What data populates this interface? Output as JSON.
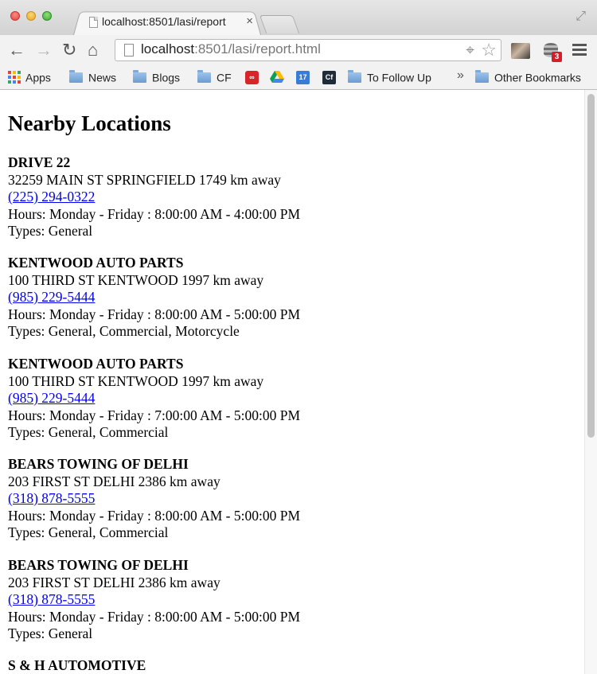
{
  "tab": {
    "title": "localhost:8501/lasi/report",
    "close": "×"
  },
  "address": {
    "host": "localhost",
    "path": ":8501/lasi/report.html"
  },
  "extensions": {
    "badge_count": "3"
  },
  "bookmarks": {
    "items": [
      {
        "label": "Apps",
        "icon": "apps-grid-icon"
      },
      {
        "label": "News",
        "icon": "folder-icon"
      },
      {
        "label": "Blogs",
        "icon": "folder-icon"
      },
      {
        "label": "CF",
        "icon": "folder-icon"
      },
      {
        "label": "",
        "icon": "adobe-cc-icon"
      },
      {
        "label": "",
        "icon": "google-drive-icon"
      },
      {
        "label": "",
        "icon": "calendar-icon",
        "text": "17"
      },
      {
        "label": "",
        "icon": "cf-icon",
        "text": "Cf"
      },
      {
        "label": "To Follow Up",
        "icon": "folder-icon"
      }
    ],
    "overflow": "»",
    "other": "Other Bookmarks"
  },
  "page": {
    "heading": "Nearby Locations",
    "locations": [
      {
        "name": "DRIVE 22",
        "address": "32259 MAIN ST SPRINGFIELD 1749 km away",
        "phone": "(225) 294-0322",
        "hours": "Hours: Monday - Friday : 8:00:00 AM - 4:00:00 PM",
        "types": "Types: General"
      },
      {
        "name": "KENTWOOD AUTO PARTS",
        "address": "100 THIRD ST KENTWOOD 1997 km away",
        "phone": "(985) 229-5444",
        "hours": "Hours: Monday - Friday : 8:00:00 AM - 5:00:00 PM",
        "types": "Types: General, Commercial, Motorcycle"
      },
      {
        "name": "KENTWOOD AUTO PARTS",
        "address": "100 THIRD ST KENTWOOD 1997 km away",
        "phone": "(985) 229-5444",
        "hours": "Hours: Monday - Friday : 7:00:00 AM - 5:00:00 PM",
        "types": "Types: General, Commercial"
      },
      {
        "name": "BEARS TOWING OF DELHI",
        "address": "203 FIRST ST DELHI 2386 km away",
        "phone": "(318) 878-5555",
        "hours": "Hours: Monday - Friday : 8:00:00 AM - 5:00:00 PM",
        "types": "Types: General, Commercial"
      },
      {
        "name": "BEARS TOWING OF DELHI",
        "address": "203 FIRST ST DELHI 2386 km away",
        "phone": "(318) 878-5555",
        "hours": "Hours: Monday - Friday : 8:00:00 AM - 5:00:00 PM",
        "types": "Types: General"
      },
      {
        "name": "S & H AUTOMOTIVE"
      }
    ]
  }
}
